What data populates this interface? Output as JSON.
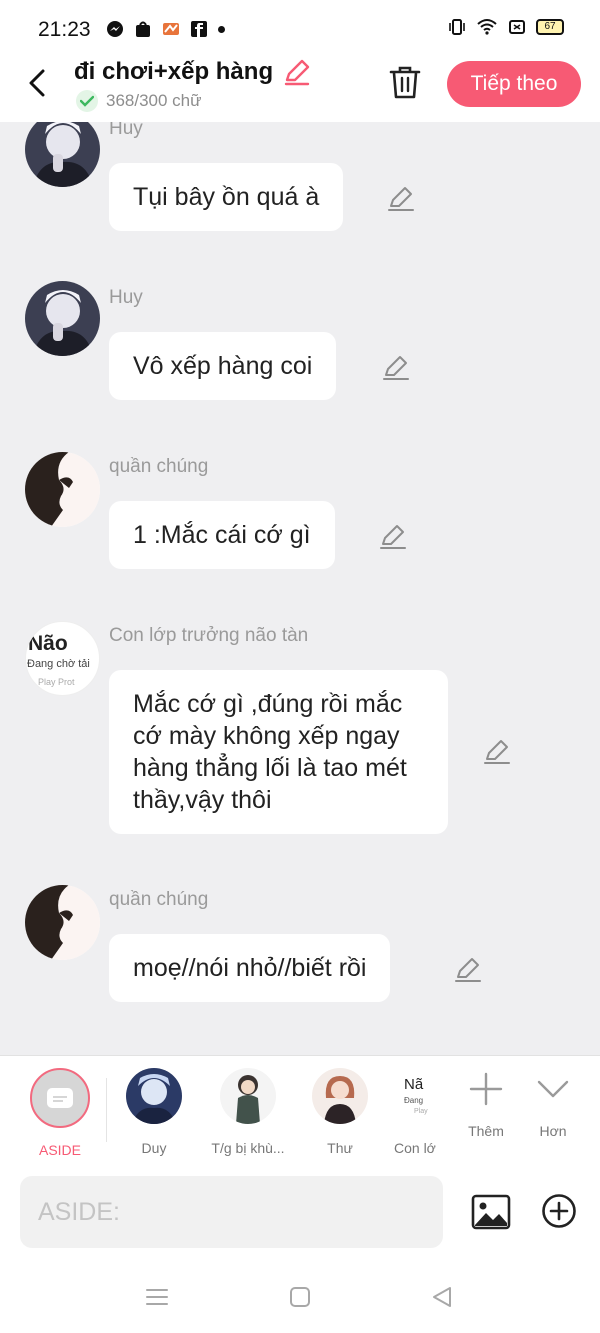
{
  "status_bar": {
    "time": "21:23",
    "battery": "67"
  },
  "header": {
    "title": "đi chơi+xếp hàng",
    "char_count": "368/300 chữ",
    "next_label": "Tiếp theo"
  },
  "messages": [
    {
      "sender": "Huy",
      "text": "Tụi bây ồn quá à"
    },
    {
      "sender": "Huy",
      "text": "Vô xếp hàng coi"
    },
    {
      "sender": "quần chúng",
      "text": "1 :Mắc cái cớ gì"
    },
    {
      "sender": "Con lớp trưởng não tàn",
      "text": "Mắc cớ gì ,đúng rồi mắc cớ mày không xếp ngay hàng thẳng lối là tao mét thầy,vậy thôi",
      "avatar_text": [
        "Não",
        "Đang chờ tải",
        "Play Prot"
      ]
    },
    {
      "sender": "quần chúng",
      "text": "moẹ//nói nhỏ//biết rồi"
    }
  ],
  "characters": [
    {
      "label": "ASIDE"
    },
    {
      "label": "Duy"
    },
    {
      "label": "T/g bị khù..."
    },
    {
      "label": "Thư"
    },
    {
      "label": "Con lớ",
      "avatar_text": [
        "Nã",
        "Đang",
        "Play"
      ]
    },
    {
      "label": "Thêm"
    },
    {
      "label": "Hơn"
    }
  ],
  "input": {
    "placeholder": "ASIDE:"
  },
  "colors": {
    "accent": "#f75a74",
    "background": "#efeff1"
  }
}
